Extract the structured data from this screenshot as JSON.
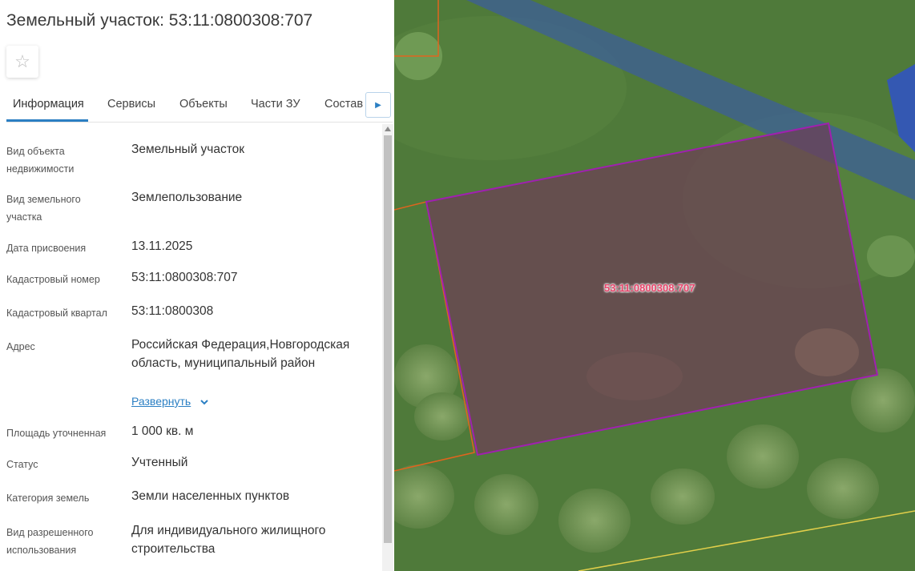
{
  "panel": {
    "title": "Земельный участок: 53:11:0800308:707",
    "favorite_icon": "star-outline-icon",
    "tabs": [
      {
        "label": "Информация",
        "active": true
      },
      {
        "label": "Сервисы",
        "active": false
      },
      {
        "label": "Объекты",
        "active": false
      },
      {
        "label": "Части ЗУ",
        "active": false
      },
      {
        "label": "Состав",
        "active": false
      }
    ],
    "tabs_next_icon": "caret-right-icon",
    "fields": [
      {
        "label": "Вид объекта недвижимости",
        "value": "Земельный участок"
      },
      {
        "label": "Вид земельного участка",
        "value": "Землепользование"
      },
      {
        "label": "Дата присвоения",
        "value": "13.11.2025"
      },
      {
        "label": "Кадастровый номер",
        "value": "53:11:0800308:707"
      },
      {
        "label": "Кадастровый квартал",
        "value": "53:11:0800308"
      },
      {
        "label": "Адрес",
        "value": "Российская Федерация,Новгородская область, муниципальный район",
        "expand_label": "Развернуть"
      },
      {
        "label": "Площадь уточненная",
        "value": "1 000 кв. м"
      },
      {
        "label": "Статус",
        "value": "Учтенный"
      },
      {
        "label": "Категория земель",
        "value": "Земли населенных пунктов"
      },
      {
        "label": "Вид разрешенного использования",
        "value": "Для индивидуального жилищного строительства"
      }
    ]
  },
  "map": {
    "parcel_label": "53:11:0800308:707",
    "colors": {
      "grass": "#4f7a3a",
      "parcel_fill": "#6e3f56",
      "parcel_border": "#a020b0",
      "road": "#3c5f9a",
      "neighbor_border": "#e0641e",
      "boundary_yellow": "#e2cf4a"
    }
  },
  "colors": {
    "accent": "#2b7fc3"
  }
}
